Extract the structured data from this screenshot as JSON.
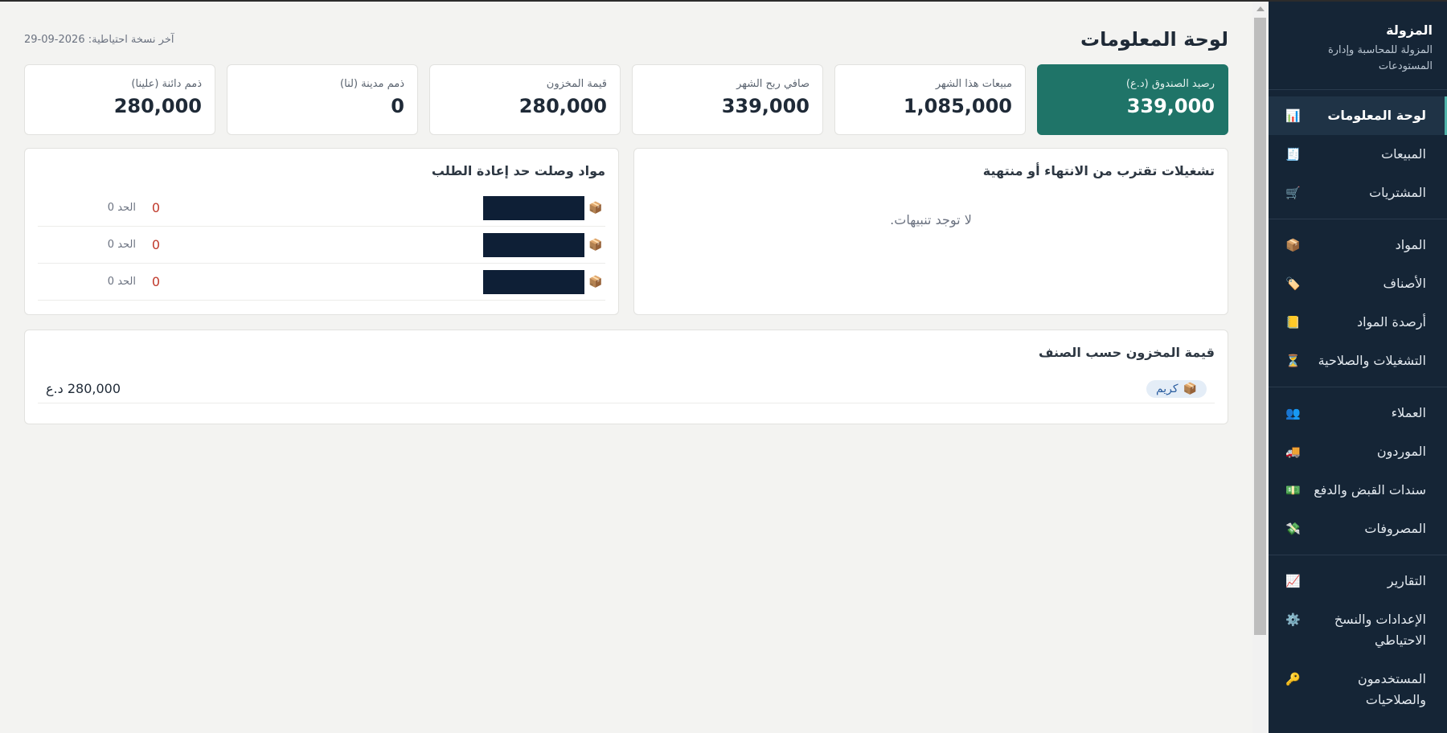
{
  "app": {
    "name": "المزولة",
    "subtitle": "المزولة للمحاسبة وإدارة المستودعات"
  },
  "sidebar": {
    "groups": [
      [
        {
          "icon": "📊",
          "label": "لوحة المعلومات",
          "active": true
        },
        {
          "icon": "🧾",
          "label": "المبيعات"
        },
        {
          "icon": "🛒",
          "label": "المشتريات"
        }
      ],
      [
        {
          "icon": "📦",
          "label": "المواد"
        },
        {
          "icon": "🏷️",
          "label": "الأصناف"
        },
        {
          "icon": "📒",
          "label": "أرصدة المواد"
        },
        {
          "icon": "⏳",
          "label": "التشغيلات والصلاحية"
        }
      ],
      [
        {
          "icon": "👥",
          "label": "العملاء"
        },
        {
          "icon": "🚚",
          "label": "الموردون"
        },
        {
          "icon": "💵",
          "label": "سندات القبض والدفع"
        },
        {
          "icon": "💸",
          "label": "المصروفات"
        }
      ],
      [
        {
          "icon": "📈",
          "label": "التقارير"
        },
        {
          "icon": "⚙️",
          "label": "الإعدادات والنسخ الاحتياطي"
        },
        {
          "icon": "🔑",
          "label": "المستخدمون والصلاحيات"
        }
      ]
    ]
  },
  "header": {
    "title": "لوحة المعلومات",
    "backup_label": "آخر نسخة احتياطية: 2026-09-29"
  },
  "cards": [
    {
      "label": "رصيد الصندوق (د.ع)",
      "value": "339,000"
    },
    {
      "label": "مبيعات هذا الشهر",
      "value": "1,085,000"
    },
    {
      "label": "صافي ربح الشهر",
      "value": "339,000"
    },
    {
      "label": "قيمة المخزون",
      "value": "280,000"
    },
    {
      "label": "ذمم مدينة (لنا)",
      "value": "0"
    },
    {
      "label": "ذمم دائنة (علينا)",
      "value": "280,000"
    }
  ],
  "batches_panel": {
    "title": "تشغيلات تقترب من الانتهاء أو منتهية",
    "empty": "لا توجد تنبيهات."
  },
  "reorder_panel": {
    "title": "مواد وصلت حد إعادة الطلب",
    "rows": [
      {
        "icon": "📦",
        "qty": "0",
        "limit": "الحد 0"
      },
      {
        "icon": "📦",
        "qty": "0",
        "limit": "الحد 0"
      },
      {
        "icon": "📦",
        "qty": "0",
        "limit": "الحد 0"
      }
    ]
  },
  "stock_by_category": {
    "title": "قيمة المخزون حسب الصنف",
    "rows": [
      {
        "icon": "📦",
        "category": "كريم",
        "value": "280,000 د.ع"
      }
    ]
  },
  "colors": {
    "sidebar_bg": "#152536",
    "accent": "#1f7468",
    "alert": "#c0392b"
  }
}
